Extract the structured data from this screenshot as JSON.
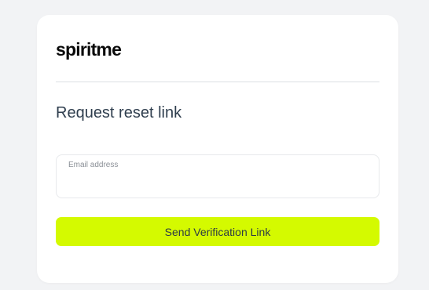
{
  "brand": {
    "logo_text": "spiritme"
  },
  "form": {
    "title": "Request reset link",
    "email_label": "Email address",
    "email_value": "",
    "submit_label": "Send Verification Link"
  },
  "colors": {
    "page_background": "#f2f3f5",
    "card_background": "#ffffff",
    "accent": "#d4fa00",
    "heading_text": "#2f3e4e"
  }
}
